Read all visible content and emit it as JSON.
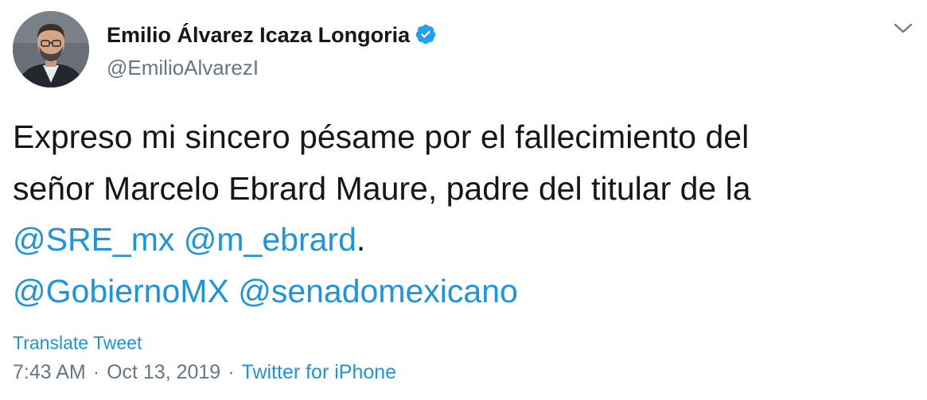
{
  "author": {
    "name": "Emilio Álvarez Icaza Longoria",
    "handle": "@EmilioAlvarezI",
    "verified_icon": "verified-badge-icon",
    "avatar": "profile-photo"
  },
  "tweet": {
    "line1": "Expreso mi sincero pésame por el fallecimiento del",
    "line2": "señor Marcelo Ebrard Maure, padre del titular de la",
    "line3_mention1": "@SRE_mx",
    "line3_mention2": "@m_ebrard",
    "line3_tail": ".",
    "line4_mention1": "@GobiernoMX",
    "line4_mention2": "@senadomexicano"
  },
  "translate_label": "Translate Tweet",
  "meta": {
    "time": "7:43 AM",
    "separator": "·",
    "date": "Oct 13, 2019",
    "source": "Twitter for iPhone"
  },
  "colors": {
    "link": "#1b95e0",
    "text": "#14171a",
    "muted": "#657786",
    "verified": "#1da1f2"
  },
  "icons": {
    "menu": "chevron-down-icon"
  }
}
